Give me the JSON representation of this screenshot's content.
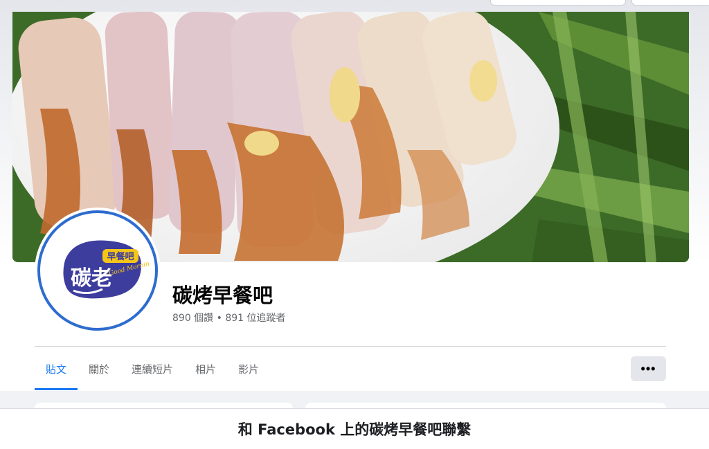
{
  "page": {
    "name": "碳烤早餐吧",
    "likes": "890 個讚",
    "separator": " • ",
    "followers": "891 位追蹤者"
  },
  "logo": {
    "main_text": "碳老",
    "badge_text": "早餐吧",
    "script_text": "Good Morning"
  },
  "tabs": [
    {
      "label": "貼文",
      "active": true
    },
    {
      "label": "關於",
      "active": false
    },
    {
      "label": "連續短片",
      "active": false
    },
    {
      "label": "相片",
      "active": false
    },
    {
      "label": "影片",
      "active": false
    }
  ],
  "more_button": {
    "label": "•••"
  },
  "login_banner": {
    "text": "和 Facebook 上的碳烤早餐吧聯繫"
  },
  "colors": {
    "accent": "#1877f2",
    "avatar_ring": "#2e6ccf",
    "logo_blob": "#3d3d9e",
    "logo_badge": "#f5c518"
  }
}
